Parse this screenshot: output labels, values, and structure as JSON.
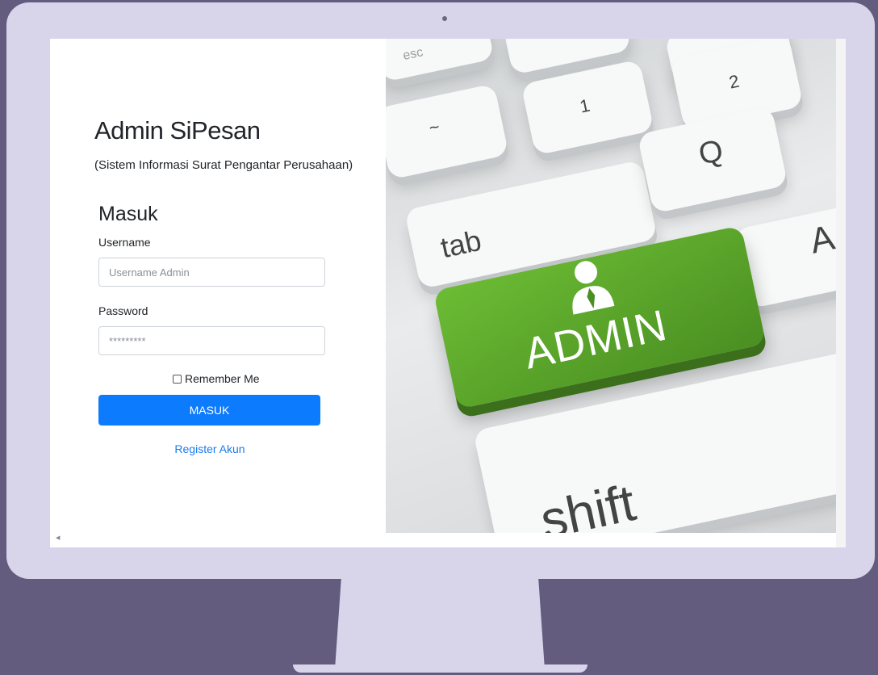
{
  "header": {
    "title": "Admin SiPesan",
    "subtitle": "(Sistem Informasi Surat Pengantar Perusahaan)"
  },
  "login": {
    "heading": "Masuk",
    "username_label": "Username",
    "username_placeholder": "Username Admin",
    "password_label": "Password",
    "password_placeholder": "*********",
    "remember_label": "Remember Me",
    "submit_label": "MASUK",
    "register_label": "Register Akun"
  },
  "hero_image": {
    "description_icon": "admin-keyboard-illustration",
    "keys": {
      "tab": "tab",
      "q": "Q",
      "one": "1",
      "two": "2",
      "admin": "ADMIN",
      "shift": "shift",
      "esc": "esc",
      "a": "A"
    },
    "accent": "#56a229"
  },
  "colors": {
    "primary": "#0d7bfd",
    "link": "#1a7bf0",
    "frame": "#d8d5eb",
    "background": "#635c7e"
  }
}
